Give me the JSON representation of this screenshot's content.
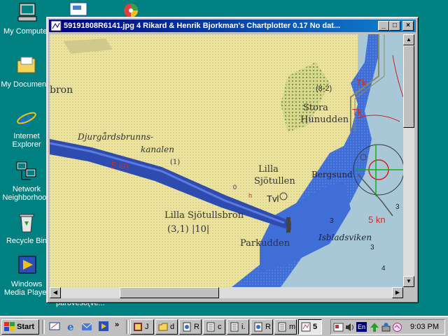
{
  "desktop": {
    "icons": [
      {
        "label": "My Computer"
      },
      {
        "label": "My Documents"
      },
      {
        "label": "Internet Explorer"
      },
      {
        "label": "Network Neighborhood"
      },
      {
        "label": "Recycle Bin"
      },
      {
        "label": "Windows Media Player"
      }
    ],
    "partial_label": "paroveso(ve..."
  },
  "window": {
    "title": "59191808R6141.jpg 4  Rikard & Henrik Bjorkman's Chartplotter 0.17  No dat...",
    "buttons": {
      "minimize": "_",
      "maximize": "□",
      "close": "×"
    }
  },
  "map": {
    "labels": {
      "bron": "bron",
      "canal_line1": "Djurgårdsbrunns-",
      "canal_line2": "kanalen",
      "canal_code": "(1)",
      "speed_left": "5 kn",
      "lilla_sjotullen_1": "Lilla",
      "lilla_sjotullen_2": "Sjötullen",
      "tvl": "Tvl",
      "sjotullsbron": "Lilla Sjötullsbron",
      "bridge_dims": "(3,1) |10|",
      "parkudden": "Parkudden",
      "stora_1": "Stora",
      "stora_2": "Hunudden",
      "stora_code": "(8-2)",
      "tk1": "Tk",
      "tk2": "Tk",
      "bergsund": "Bergsund",
      "speed_right": "5 kn",
      "isbladsviken": "Isbladsviken",
      "depth_3a": "3",
      "depth_3b": "3",
      "depth_3c": "3",
      "depth_0": "0",
      "depth_4": "4",
      "tiny_h": "h"
    },
    "colors": {
      "land": "#ebe39e",
      "water_deep": "#3f6fd6",
      "water_shallow": "#a8c8d8",
      "channel": "#2e4bb0",
      "speed_red": "#c0302f",
      "cursor_green": "#10b010",
      "cursor_red": "#d02020"
    }
  },
  "taskbar": {
    "start_label": "Start",
    "buttons": [
      {
        "label": "J",
        "icon": "app-icon"
      },
      {
        "label": "d",
        "icon": "folder-icon"
      },
      {
        "label": "R",
        "icon": "document-icon"
      },
      {
        "label": "c",
        "icon": "notepad-icon"
      },
      {
        "label": "i.",
        "icon": "notepad-icon"
      },
      {
        "label": "R",
        "icon": "document-icon"
      },
      {
        "label": "m",
        "icon": "notepad-icon"
      },
      {
        "label": "5",
        "icon": "chartplotter-icon",
        "active": true
      }
    ],
    "tray": {
      "language": "En",
      "clock": "9:03 PM"
    }
  }
}
